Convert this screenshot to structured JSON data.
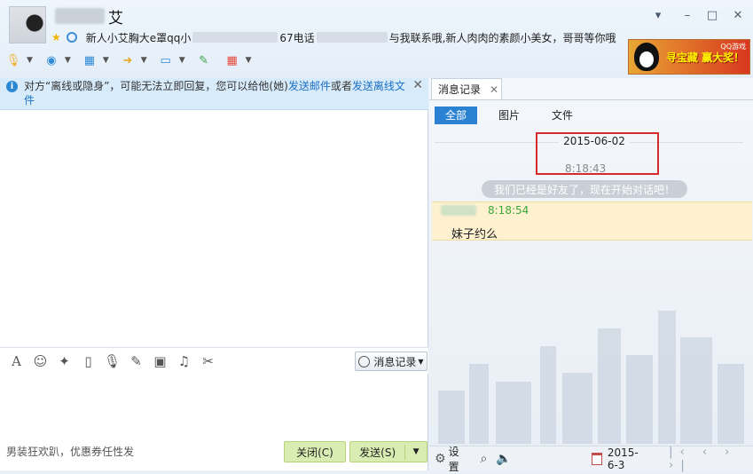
{
  "header": {
    "contact_name_suffix": "艾",
    "signature": {
      "part1": "新人小艾胸大e罩qq小",
      "part2": "67电话",
      "part3": "与我联系哦,新人肉肉的素颜小美女，哥哥等你哦"
    },
    "window_controls": {
      "menu": "▾",
      "minimize": "–",
      "maximize": "□",
      "close": "✕"
    },
    "toolbar": [
      {
        "icon": "microphone-icon",
        "glyph": "🎙",
        "color": "#f1b12e"
      },
      {
        "icon": "webcam-icon",
        "glyph": "◉",
        "color": "#2f8bd6"
      },
      {
        "icon": "screen-share-icon",
        "glyph": "▦",
        "color": "#2f8bd6"
      },
      {
        "icon": "file-transfer-icon",
        "glyph": "➜",
        "color": "#e7a92a"
      },
      {
        "icon": "remote-desktop-icon",
        "glyph": "▭",
        "color": "#2f8bd6"
      },
      {
        "icon": "message-icon",
        "glyph": "✎",
        "color": "#3aa54a"
      },
      {
        "icon": "apps-icon",
        "glyph": "▦",
        "color": "#e44c3c"
      }
    ],
    "ad": {
      "text": "寻宝藏 赢大奖！",
      "brand": "QQ游戏"
    }
  },
  "notice": {
    "prefix": "对方“离线或隐身”，可能无法立即回复，您可以给他(她)",
    "link1": "发送邮件",
    "middle": "或者",
    "link2": "发送离线文件",
    "close": "✕"
  },
  "input_toolbar": {
    "icons": [
      {
        "name": "font-icon",
        "glyph": "A"
      },
      {
        "name": "emoji-icon",
        "glyph": "☺"
      },
      {
        "name": "nudge-icon",
        "glyph": "✦"
      },
      {
        "name": "gif-icon",
        "glyph": "▯"
      },
      {
        "name": "voice-message-icon",
        "glyph": "🎙"
      },
      {
        "name": "edit-icon",
        "glyph": "✎"
      },
      {
        "name": "image-icon",
        "glyph": "▣"
      },
      {
        "name": "music-icon",
        "glyph": "♫"
      },
      {
        "name": "scissors-icon",
        "glyph": "✂"
      }
    ],
    "history_button": "消息记录"
  },
  "footer": {
    "ad_slogan": "男装狂欢趴，优惠券任性发",
    "close_button": "关闭(C)",
    "send_button": "发送(S)"
  },
  "history_panel": {
    "tab_label": "消息记录",
    "tab_close": "✕",
    "filters": [
      "全部",
      "图片",
      "文件"
    ],
    "date": "2015-06-02",
    "first_time": "8:18:43",
    "system_message": "我们已经是好友了，现在开始对话吧！",
    "message": {
      "time": "8:18:54",
      "text": "妹子约么"
    },
    "bottom": {
      "settings_label": "设置",
      "date": "2015-6-3",
      "nav": "|‹ ‹ › ›|"
    }
  }
}
